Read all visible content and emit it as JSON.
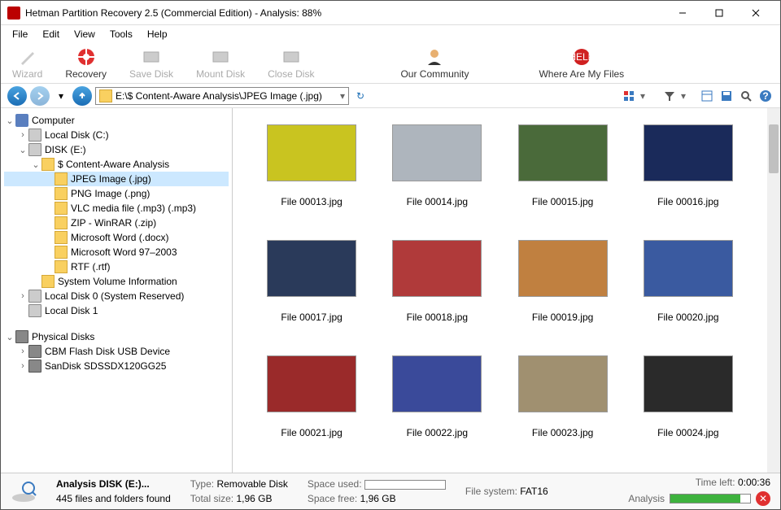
{
  "window": {
    "title": "Hetman Partition Recovery 2.5 (Commercial Edition) - Analysis: 88%"
  },
  "menu": [
    "File",
    "Edit",
    "View",
    "Tools",
    "Help"
  ],
  "toolbar": [
    {
      "label": "Wizard",
      "disabled": true
    },
    {
      "label": "Recovery",
      "disabled": false
    },
    {
      "label": "Save Disk",
      "disabled": true
    },
    {
      "label": "Mount Disk",
      "disabled": true
    },
    {
      "label": "Close Disk",
      "disabled": true
    },
    {
      "label": "Our Community",
      "disabled": false
    },
    {
      "label": "Where Are My Files",
      "disabled": false
    }
  ],
  "address": "E:\\$ Content-Aware Analysis\\JPEG Image (.jpg)",
  "tree": {
    "root1": "Computer",
    "drives": [
      {
        "name": "Local Disk (C:)",
        "icon": "disk"
      },
      {
        "name": "DISK (E:)",
        "icon": "disk",
        "expanded": true,
        "children": [
          {
            "name": "$ Content-Aware Analysis",
            "icon": "folder",
            "expanded": true,
            "children": [
              {
                "name": "JPEG Image (.jpg)",
                "icon": "folder",
                "selected": true
              },
              {
                "name": "PNG Image (.png)",
                "icon": "folder"
              },
              {
                "name": "VLC media file (.mp3) (.mp3)",
                "icon": "folder"
              },
              {
                "name": "ZIP - WinRAR (.zip)",
                "icon": "folder"
              },
              {
                "name": "Microsoft Word (.docx)",
                "icon": "folder"
              },
              {
                "name": "Microsoft Word 97–2003",
                "icon": "folder"
              },
              {
                "name": "RTF (.rtf)",
                "icon": "folder"
              }
            ]
          },
          {
            "name": "System Volume Information",
            "icon": "folder"
          }
        ]
      },
      {
        "name": "Local Disk 0 (System Reserved)",
        "icon": "disk"
      },
      {
        "name": "Local Disk 1",
        "icon": "disk"
      }
    ],
    "root2": "Physical Disks",
    "physical": [
      {
        "name": "CBM Flash Disk USB Device",
        "icon": "drive"
      },
      {
        "name": "SanDisk SDSSDX120GG25",
        "icon": "drive"
      }
    ]
  },
  "files": [
    {
      "name": "File 00013.jpg",
      "bg": "#c9c420"
    },
    {
      "name": "File 00014.jpg",
      "bg": "#aeb5bd"
    },
    {
      "name": "File 00015.jpg",
      "bg": "#4a6a3a"
    },
    {
      "name": "File 00016.jpg",
      "bg": "#1a2a5a"
    },
    {
      "name": "File 00017.jpg",
      "bg": "#2a3a5a"
    },
    {
      "name": "File 00018.jpg",
      "bg": "#b03a3a"
    },
    {
      "name": "File 00019.jpg",
      "bg": "#c08040"
    },
    {
      "name": "File 00020.jpg",
      "bg": "#3a5aa0"
    },
    {
      "name": "File 00021.jpg",
      "bg": "#9a2a2a"
    },
    {
      "name": "File 00022.jpg",
      "bg": "#3a4a9a"
    },
    {
      "name": "File 00023.jpg",
      "bg": "#a09070"
    },
    {
      "name": "File 00024.jpg",
      "bg": "#2a2a2a"
    }
  ],
  "status": {
    "title": "Analysis DISK (E:)...",
    "count": "445 files and folders found",
    "type_label": "Type:",
    "type_value": "Removable Disk",
    "total_label": "Total size:",
    "total_value": "1,96 GB",
    "used_label": "Space used:",
    "free_label": "Space free:",
    "free_value": "1,96 GB",
    "fs_label": "File system:",
    "fs_value": "FAT16",
    "time_label": "Time left:",
    "time_value": "0:00:36",
    "analysis_label": "Analysis"
  }
}
